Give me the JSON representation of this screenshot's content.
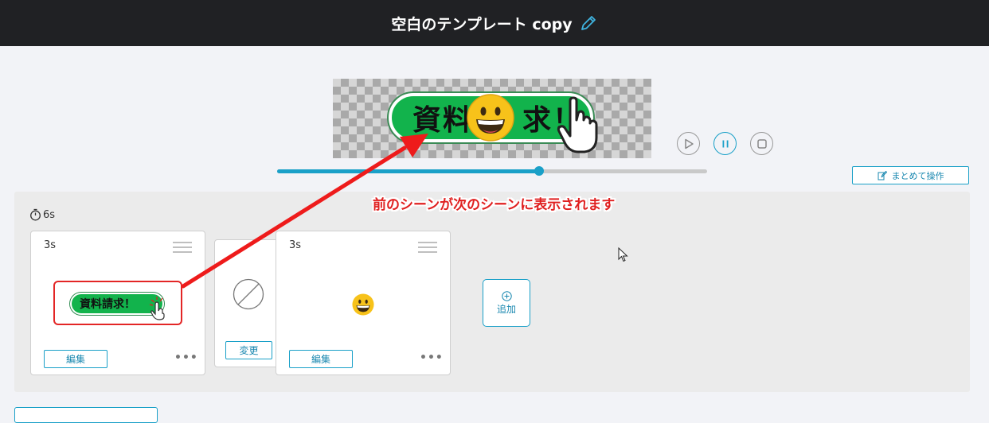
{
  "header": {
    "title": "空白のテンプレート copy",
    "edit_icon": "pencil-icon"
  },
  "preview": {
    "banner_text_left": "資料",
    "banner_text_right": "求！",
    "emoji_icon": "grinning-face-icon",
    "hand_icon": "pointing-hand-icon"
  },
  "player": {
    "play_icon": "play-icon",
    "pause_icon": "pause-icon",
    "stop_icon": "stop-icon",
    "progress": 0.61
  },
  "toolbar": {
    "bulk_label": "まとめて操作",
    "bulk_icon": "edit-note-icon"
  },
  "scenes": {
    "total_duration": "6s",
    "timer_icon": "stopwatch-icon",
    "items": [
      {
        "duration": "3s",
        "thumbnail_text": "資料請求！",
        "edit_label": "編集",
        "more_label": "•••"
      },
      {
        "duration": "3s",
        "thumbnail_icon": "grinning-face-icon",
        "edit_label": "編集",
        "more_label": "•••"
      }
    ],
    "transition": {
      "icon": "no-transition-icon",
      "change_label": "変更"
    },
    "add_label": "追加",
    "add_icon": "plus-circle-icon"
  },
  "annotation": {
    "callout_text": "前のシーンが次のシーンに表示されます",
    "color": "#e02020"
  },
  "colors": {
    "accent": "#1aa0c8",
    "header_bg": "#202124",
    "banner_green": "#12b34c"
  }
}
